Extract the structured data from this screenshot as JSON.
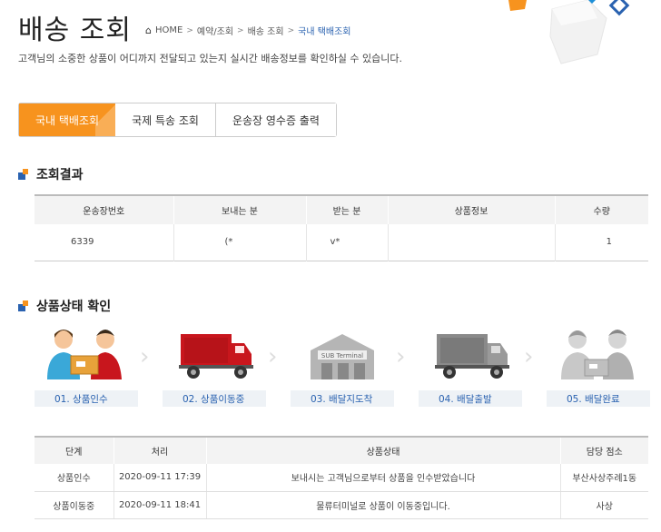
{
  "page": {
    "title": "배송 조회",
    "subtitle": "고객님의 소중한 상품이 어디까지 전달되고 있는지 실시간 배송정보를 확인하실 수 있습니다."
  },
  "breadcrumb": {
    "home": "HOME",
    "items": [
      "예약/조회",
      "배송 조회"
    ],
    "current": "국내 택배조회",
    "sep": ">"
  },
  "tabs": [
    "국내 택배조회",
    "국제 특송 조회",
    "운송장 영수증 출력"
  ],
  "result": {
    "heading": "조회결과",
    "columns": [
      "운송장번호",
      "보내는 분",
      "받는 분",
      "상품정보",
      "수량"
    ],
    "row": [
      "6339",
      "(*",
      "v*",
      "",
      "1"
    ]
  },
  "status": {
    "heading": "상품상태 확인",
    "steps": [
      "01. 상품인수",
      "02. 상품이동중",
      "03. 배달지도착",
      "04. 배달출발",
      "05. 배달완료"
    ],
    "terminal_sign": "SUB Terminal"
  },
  "history": {
    "columns": [
      "단계",
      "처리",
      "상품상태",
      "담당 점소"
    ],
    "rows": [
      [
        "상품인수",
        "2020-09-11 17:39",
        "보내시는 고객님으로부터 상품을 인수받았습니다",
        "부산사상주례1동"
      ],
      [
        "상품이동중",
        "2020-09-11 18:41",
        "물류터미널로 상품이 이동중입니다.",
        "사상"
      ]
    ]
  },
  "colors": {
    "accent": "#f7931e",
    "brand_blue": "#2a62b0",
    "truck_red": "#c8161d"
  }
}
